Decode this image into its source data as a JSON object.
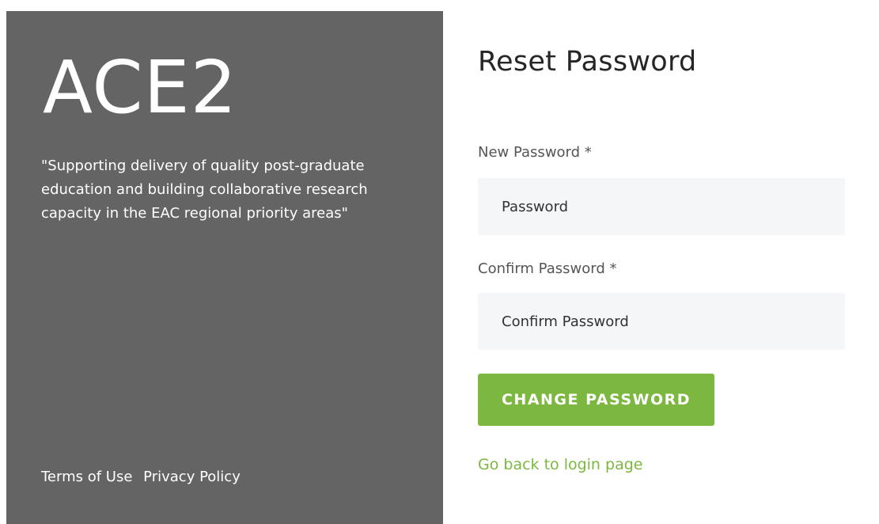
{
  "brand": {
    "name": "ACE2",
    "tagline": "\"Supporting delivery of quality post-graduate education and building collaborative research capacity in the EAC regional priority areas\""
  },
  "footer": {
    "terms_label": "Terms of Use",
    "privacy_label": "Privacy Policy"
  },
  "form": {
    "title": "Reset Password",
    "new_password": {
      "label": "New Password *",
      "placeholder": "Password"
    },
    "confirm_password": {
      "label": "Confirm Password *",
      "placeholder": "Confirm Password"
    },
    "submit_label": "CHANGE PASSWORD",
    "back_link_label": "Go back to login page"
  },
  "colors": {
    "left_panel_bg": "#646464",
    "accent": "#7cb83f",
    "input_bg": "#f5f6f8"
  }
}
